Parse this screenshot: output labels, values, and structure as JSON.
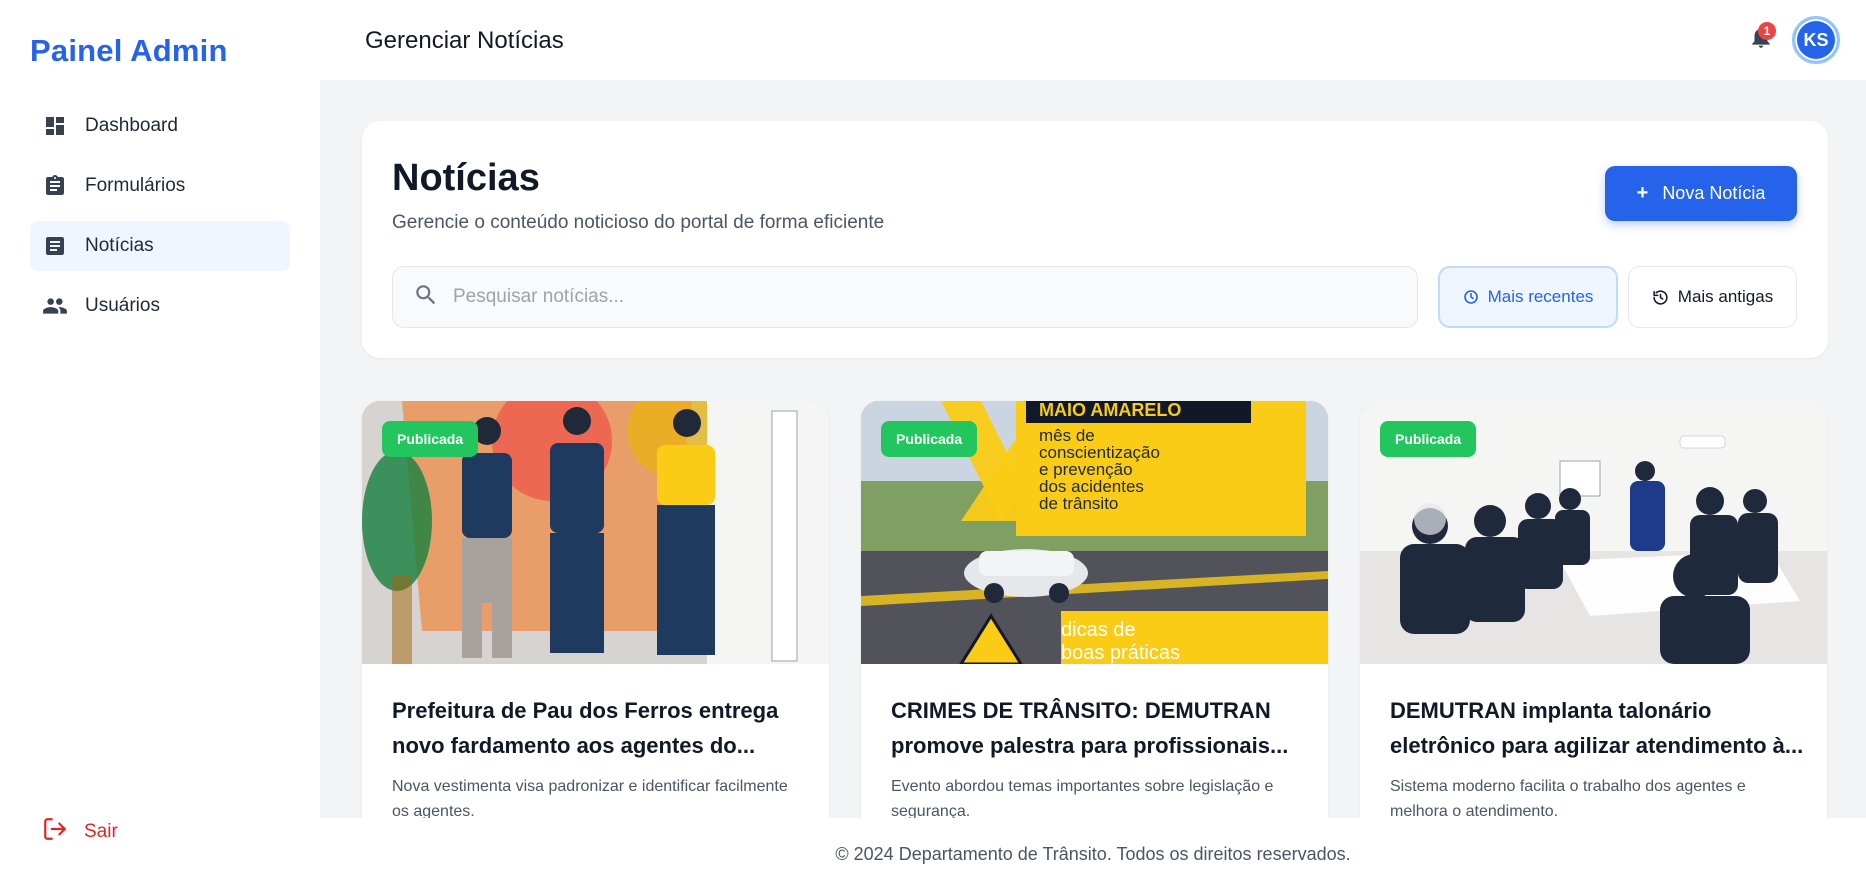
{
  "sidebar": {
    "brand": "Painel Admin",
    "items": [
      {
        "label": "Dashboard",
        "icon": "dashboard-icon",
        "active": false
      },
      {
        "label": "Formulários",
        "icon": "clipboard-icon",
        "active": false
      },
      {
        "label": "Notícias",
        "icon": "article-icon",
        "active": true
      },
      {
        "label": "Usuários",
        "icon": "users-icon",
        "active": false
      }
    ],
    "logout_label": "Sair"
  },
  "header": {
    "title": "Gerenciar Notícias",
    "notification_count": "1",
    "avatar_initials": "KS"
  },
  "panel": {
    "title": "Notícias",
    "subtitle": "Gerencie o conteúdo noticioso do portal de forma eficiente",
    "new_button": "Nova Notícia",
    "search_placeholder": "Pesquisar notícias...",
    "search_value": "",
    "sort_recent": "Mais recentes",
    "sort_old": "Mais antigas"
  },
  "cards": [
    {
      "status": "Publicada",
      "title": "Prefeitura de Pau dos Ferros entrega novo fardamento aos agentes do...",
      "description": "Nova vestimenta visa padronizar e identificar facilmente os agentes."
    },
    {
      "status": "Publicada",
      "title": "CRIMES DE TRÂNSITO: DEMUTRAN promove palestra para profissionais...",
      "description": "Evento abordou temas importantes sobre legislação e segurança.",
      "image_text": {
        "headline": "MAIO AMARELO",
        "line1": "mês de",
        "line2": "conscientização",
        "line3": "e prevenção",
        "line4": "dos acidentes",
        "line5": "de trânsito",
        "bottom1": "dicas de",
        "bottom2": "boas práticas"
      }
    },
    {
      "status": "Publicada",
      "title": "DEMUTRAN implanta talonário eletrônico para agilizar atendimento à...",
      "description": "Sistema moderno facilita o trabalho dos agentes e melhora o atendimento."
    }
  ],
  "footer": {
    "text": "© 2024 Departamento de Trânsito. Todos os direitos reservados."
  },
  "colors": {
    "primary": "#2563eb",
    "success": "#22c55e",
    "danger": "#dc2626",
    "background": "#f3f4f6"
  }
}
